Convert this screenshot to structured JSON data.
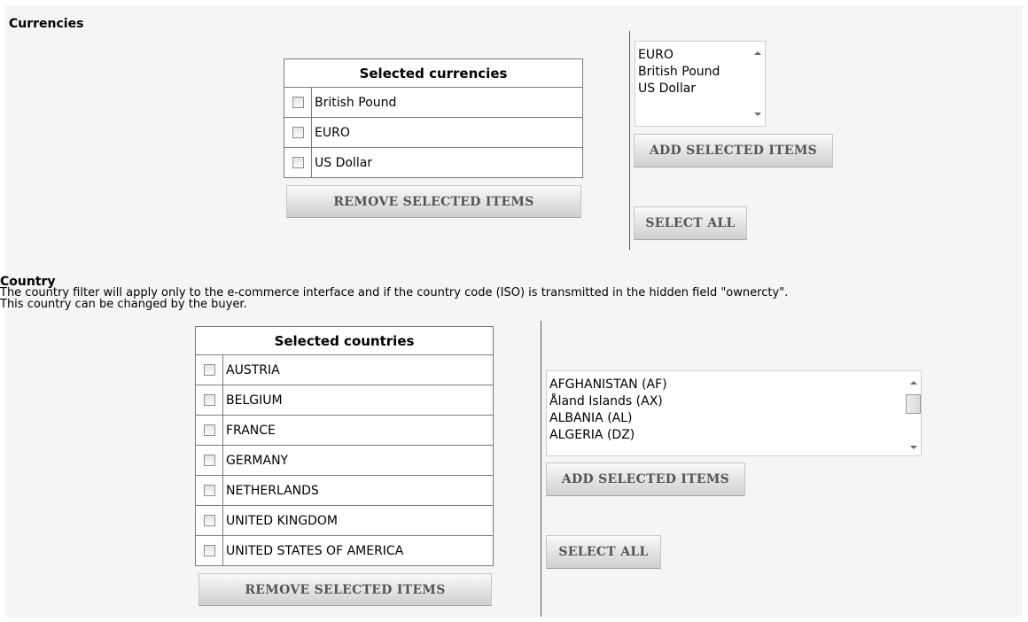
{
  "currencies": {
    "title": "Currencies",
    "selected_header": "Selected currencies",
    "selected_items": [
      "British Pound",
      "EURO",
      "US Dollar"
    ],
    "remove_button": "REMOVE SELECTED ITEMS",
    "available_options": [
      "EURO",
      "British Pound",
      "US Dollar"
    ],
    "add_button": "ADD SELECTED ITEMS",
    "select_all_button": "SELECT ALL"
  },
  "country": {
    "title": "Country",
    "description_line1": "The country filter will apply only to the e-commerce interface and if the country code (ISO) is transmitted in the hidden field \"ownercty\".",
    "description_line2": "This country can be changed by the buyer.",
    "selected_header": "Selected countries",
    "selected_items": [
      "AUSTRIA",
      "BELGIUM",
      "FRANCE",
      "GERMANY",
      "NETHERLANDS",
      "UNITED KINGDOM",
      "UNITED STATES OF AMERICA"
    ],
    "remove_button": "REMOVE SELECTED ITEMS",
    "available_options": [
      "AFGHANISTAN (AF)",
      "Åland Islands (AX)",
      "ALBANIA (AL)",
      "ALGERIA (DZ)"
    ],
    "add_button": "ADD SELECTED ITEMS",
    "select_all_button": "SELECT ALL"
  }
}
